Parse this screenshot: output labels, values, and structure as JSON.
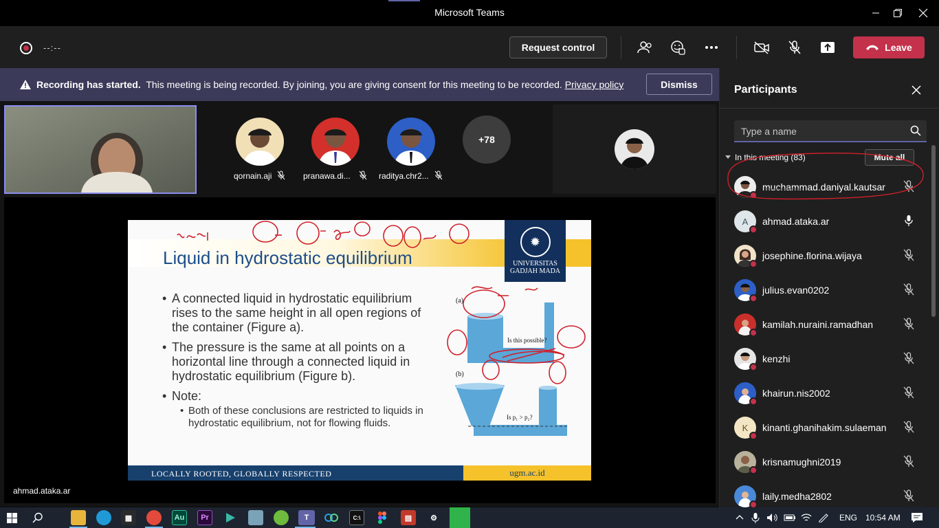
{
  "window": {
    "title": "Microsoft Teams"
  },
  "toolbar": {
    "timer": "--:--",
    "request_control_label": "Request control",
    "leave_label": "Leave",
    "icons": [
      "people-icon",
      "reactions-icon",
      "more-icon",
      "camera-off-icon",
      "mic-off-icon",
      "share-tray-icon"
    ]
  },
  "banner": {
    "bold_text": "Recording has started.",
    "text": "This meeting is being recorded. By joining, you are giving consent for this meeting to be recorded.",
    "link_text": "Privacy policy",
    "dismiss_label": "Dismiss"
  },
  "stage": {
    "tiles": [
      {
        "name": "qornain.aji",
        "muted": true
      },
      {
        "name": "pranawa.di...",
        "muted": true
      },
      {
        "name": "raditya.chr2...",
        "muted": true
      }
    ],
    "more_count": "+78",
    "presenter_name": "ahmad.ataka.ar"
  },
  "slide": {
    "title": "Liquid in hydrostatic equilibrium",
    "logo_line1": "UNIVERSITAS",
    "logo_line2": "GADJAH MADA",
    "bullet1": "A connected liquid in hydrostatic equilibrium rises to the same height in all open regions of the container (Figure a).",
    "bullet2": "The pressure is the same at all points on a horizontal line through a connected liquid in hydrostatic equilibrium (Figure b).",
    "bullet3": "Note:",
    "sub_bullet": "Both of these conclusions are restricted to liquids in hydrostatic equilibrium, not for flowing fluids.",
    "fig_a": "(a)",
    "fig_b": "(b)",
    "fig_question_a": "Is this possible?",
    "fig_question_b": "Is p₁ > p₂?",
    "footer_left": "LOCALLY ROOTED, GLOBALLY RESPECTED",
    "footer_right": "ugm.ac.id"
  },
  "panel": {
    "title": "Participants",
    "search_placeholder": "Type a name",
    "section_label": "In this meeting (83)",
    "mute_all_label": "Mute all",
    "participants": [
      {
        "name": "muchammad.daniyal.kautsar",
        "initial": "",
        "mic": "muted"
      },
      {
        "name": "ahmad.ataka.ar",
        "initial": "A",
        "mic": "on"
      },
      {
        "name": "josephine.florina.wijaya",
        "initial": "",
        "mic": "muted"
      },
      {
        "name": "julius.evan0202",
        "initial": "",
        "mic": "muted"
      },
      {
        "name": "kamilah.nuraini.ramadhan",
        "initial": "",
        "mic": "muted"
      },
      {
        "name": "kenzhi",
        "initial": "",
        "mic": "muted"
      },
      {
        "name": "khairun.nis2002",
        "initial": "",
        "mic": "muted"
      },
      {
        "name": "kinanti.ghanihakim.sulaeman",
        "initial": "K",
        "mic": "muted"
      },
      {
        "name": "krisnamughni2019",
        "initial": "",
        "mic": "muted"
      },
      {
        "name": "laily.medha2802",
        "initial": "",
        "mic": "muted"
      }
    ]
  },
  "taskbar": {
    "language": "ENG",
    "time": "10:54 AM"
  },
  "colors": {
    "accent": "#6264a7",
    "leave": "#c4314b",
    "banner": "#3b3a59",
    "annotation": "#d0202a"
  }
}
